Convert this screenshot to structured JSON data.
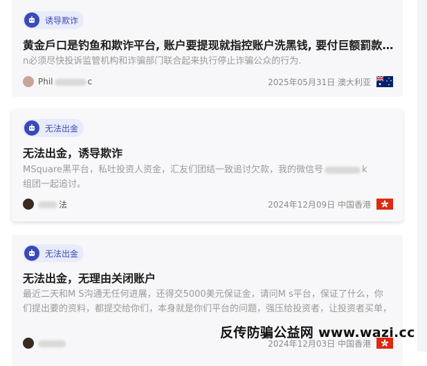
{
  "posts": [
    {
      "tag": "诱导欺诈",
      "title": "黄金戶口是钓鱼和欺诈平台, 账户要提现就指控账户洗黑钱, 要付巨额罰款....",
      "body": "n必须尽快投诉监管机构和诈骗部门联合起来执行停止诈骗公众的行为.",
      "author_visible": "Phil",
      "author_tail": "c",
      "date": "2025年05月31日",
      "region": "澳大利亚",
      "flag_icon": "australia-flag-icon"
    },
    {
      "tag": "无法出金",
      "title": "无法出金，诱导欺诈",
      "body_line1_start": "MSquare黑平台，私吐投资人资金，汇友们团结一致追讨欠款，我的微信号",
      "body_line1_end": "k",
      "body_line2": "组团一起追讨。",
      "author_visible": "法",
      "date": "2024年12月09日",
      "region": "中国香港",
      "flag_icon": "hong-kong-flag-icon"
    },
    {
      "tag": "无法出金",
      "title": "无法出金，无理由关闭账户",
      "body": "最近二天和M S沟通无任何进展，还得交5000美元保证金，请问M s平台，保证了什么，你们提出要的资料，都提交给你们，本身就是你们平台的问题，强压给投资者，让投资者买单，",
      "date": "2024年12月03日",
      "region": "中国香港",
      "flag_icon": "hong-kong-flag-icon"
    }
  ],
  "watermark": "反传防骗公益网 www.wazi.cc",
  "colors": {
    "tag_bg": "#e8ebfa",
    "tag_accent": "#3a4ab8",
    "card_bg": "#f7f7f9",
    "hk_red": "#de2910"
  },
  "tag_icon": "robot-shield-icon"
}
